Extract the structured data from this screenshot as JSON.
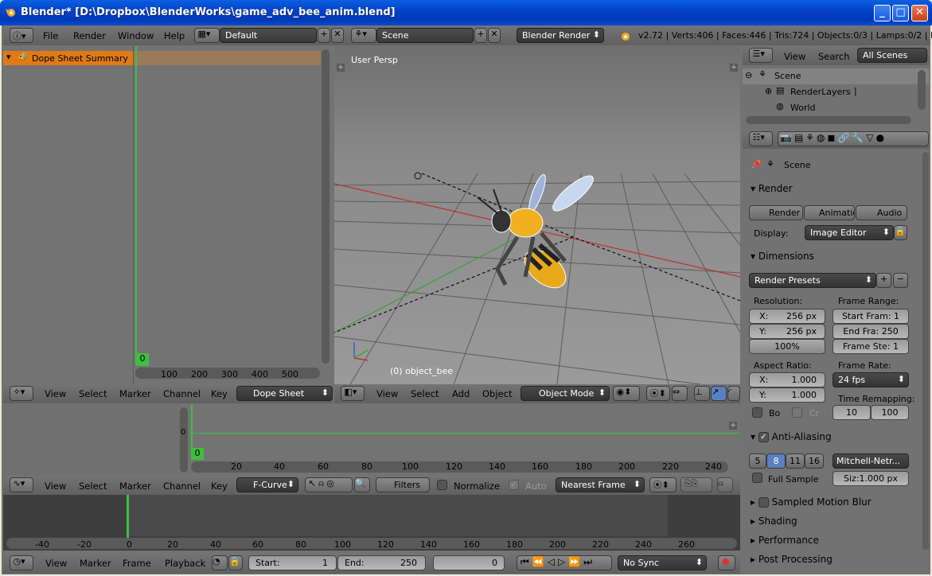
{
  "window": {
    "title": "Blender* [D:\\Dropbox\\BlenderWorks\\game_adv_bee_anim.blend]",
    "min": "_",
    "max": "□",
    "close": "✕"
  },
  "topbar": {
    "menus": [
      "File",
      "Render",
      "Window",
      "Help"
    ],
    "layout": "Default",
    "scene": "Scene",
    "engine": "Blender Render",
    "stats": "v2.72 | Verts:406 | Faces:446 | Tris:724 | Objects:0/3 | Lamps:0/2 | Mem"
  },
  "dopesheet": {
    "summary": "Dope Sheet Summary",
    "frame_marker": "0",
    "ruler": [
      "100",
      "200",
      "300",
      "400",
      "500"
    ],
    "menus": [
      "View",
      "Select",
      "Marker",
      "Channel",
      "Key"
    ],
    "mode": "Dope Sheet"
  },
  "viewport": {
    "label": "User Persp",
    "object_label": "(0) object_bee",
    "menus": [
      "View",
      "Select",
      "Add",
      "Object"
    ],
    "mode": "Object Mode"
  },
  "graph": {
    "frame_marker": "0",
    "ruler": [
      "20",
      "40",
      "60",
      "80",
      "100",
      "120",
      "140",
      "160",
      "180",
      "200",
      "220",
      "240"
    ],
    "menus": [
      "View",
      "Select",
      "Marker",
      "Channel",
      "Key"
    ],
    "mode": "F-Curve",
    "filters": "Filters",
    "normalize": "Normalize",
    "auto": "Auto",
    "snap": "Nearest Frame"
  },
  "timeline": {
    "ruler": [
      "-40",
      "-20",
      "0",
      "20",
      "40",
      "60",
      "80",
      "100",
      "120",
      "140",
      "160",
      "180",
      "200",
      "220",
      "240",
      "260"
    ],
    "menus": [
      "View",
      "Marker",
      "Frame",
      "Playback"
    ],
    "start_label": "Start:",
    "start": "1",
    "end_label": "End:",
    "end": "250",
    "current": "0",
    "sync": "No Sync"
  },
  "outliner": {
    "menus": [
      "View",
      "Search"
    ],
    "filter": "All Scenes",
    "items": [
      "Scene",
      "RenderLayers",
      "World"
    ]
  },
  "properties": {
    "context": "Scene",
    "render": {
      "title": "Render",
      "buttons": [
        "Render",
        "Animatio",
        "Audio"
      ],
      "display_label": "Display:",
      "display": "Image Editor"
    },
    "dimensions": {
      "title": "Dimensions",
      "presets": "Render Presets",
      "resolution_label": "Resolution:",
      "x": "256 px",
      "y": "256 px",
      "pct": "100%",
      "range_label": "Frame Range:",
      "start": "Start Fram: 1",
      "end": "End Fra: 250",
      "step": "Frame Ste: 1",
      "aspect_label": "Aspect Ratio:",
      "ax": "1.000",
      "ay": "1.000",
      "rate_label": "Frame Rate:",
      "rate": "24 fps",
      "remap_label": "Time Remapping:",
      "old": "10",
      "new": "100",
      "bo": "Bo",
      "cr": "Cr",
      "x_label": "X:",
      "y_label": "Y:"
    },
    "aa": {
      "title": "Anti-Aliasing",
      "samples": [
        "5",
        "8",
        "11",
        "16"
      ],
      "filter": "Mitchell-Netr...",
      "full": "Full Sample",
      "size": "Siz:1.000 px"
    },
    "collapsed": [
      "Sampled Motion Blur",
      "Shading",
      "Performance",
      "Post Processing"
    ]
  }
}
